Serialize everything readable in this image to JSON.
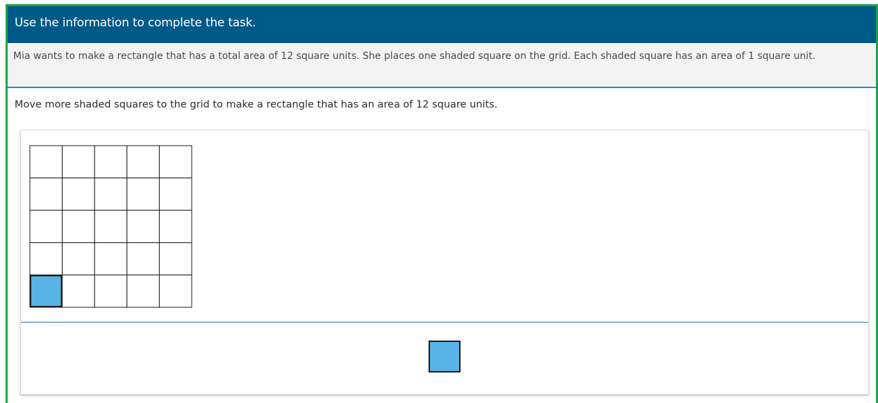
{
  "header": {
    "title": "Use the information to complete the task."
  },
  "stimulus": {
    "text": "Mia wants to make a rectangle that has a total area of 12 square units. She places one shaded square on the grid. Each shaded square has an area of 1 square unit."
  },
  "task": {
    "prompt": "Move more shaded squares to the grid to make a rectangle that has an area of 12 square units."
  },
  "grid": {
    "rows": 5,
    "cols": 5,
    "shaded_cells": [
      {
        "row": 4,
        "col": 0
      }
    ]
  },
  "palette": {
    "tiles": [
      {
        "label": "shaded-square"
      }
    ]
  },
  "colors": {
    "header_bg": "#005a87",
    "frame_border": "#1fa34a",
    "shaded_square": "#58b3e6",
    "divider": "#2a6f9e"
  }
}
